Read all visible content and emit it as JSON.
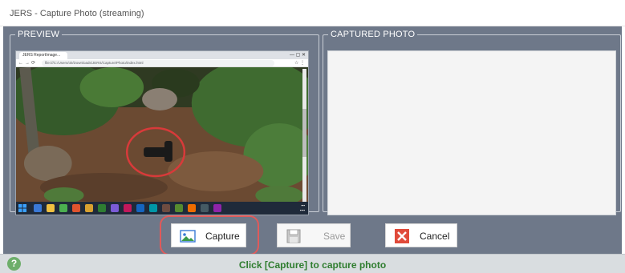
{
  "window": {
    "title": "JERS - Capture Photo (streaming)"
  },
  "preview": {
    "legend": "PREVIEW",
    "inner_browser": {
      "tab_label": "JERS ReportImage...",
      "url": "file:///C:/Users/ok/Downloads/JERS/Capture/Photo/index.html"
    }
  },
  "captured": {
    "legend": "CAPTURED PHOTO"
  },
  "buttons": {
    "capture": {
      "label": "Capture",
      "icon": "image-icon"
    },
    "save": {
      "label": "Save",
      "icon": "floppy-disk-icon",
      "enabled": false
    },
    "cancel": {
      "label": "Cancel",
      "icon": "close-x-icon",
      "color": "#e04a3a"
    }
  },
  "status": {
    "message": "Click [Capture] to capture photo",
    "help_icon": "?"
  },
  "colors": {
    "client_bg": "#6e7889",
    "status_text": "#2f7d2f",
    "highlight_ring": "#e05a5a"
  }
}
